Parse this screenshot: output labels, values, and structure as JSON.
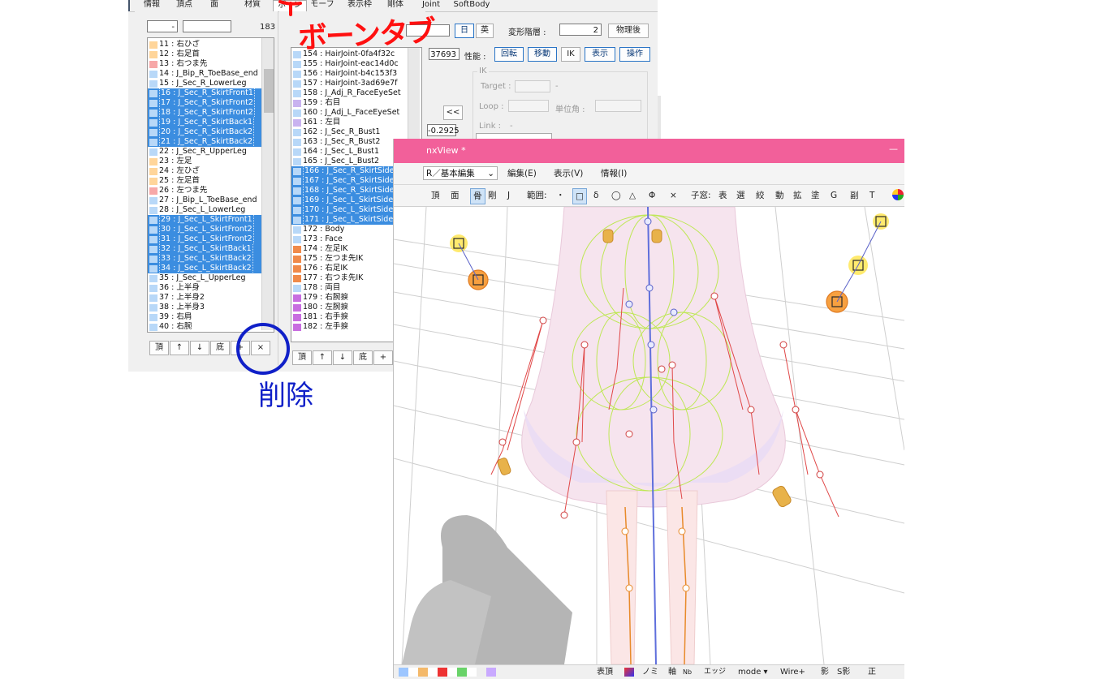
{
  "tabs": [
    "情報",
    "頂点",
    "面",
    "材質",
    "ボーン",
    "モーフ",
    "表示枠",
    "剛体",
    "Joint",
    "SoftBody"
  ],
  "active_tab": "ボーン",
  "left": {
    "spin_value": "-",
    "name_value": "",
    "count": "183",
    "rows": [
      {
        "label": "11 : 右ひざ",
        "color": "#ffd59a",
        "sel": false
      },
      {
        "label": "12 : 右足首",
        "color": "#ffd59a",
        "sel": false
      },
      {
        "label": "13 : 右つま先",
        "color": "#f7a8a8",
        "sel": false
      },
      {
        "label": "14 : J_Bip_R_ToeBase_end",
        "color": "#b8d8f8",
        "sel": false
      },
      {
        "label": "15 : J_Sec_R_LowerLeg",
        "color": "#b8d8f8",
        "sel": false
      },
      {
        "label": "16 : J_Sec_R_SkirtFront1",
        "color": "#b8d8f8",
        "sel": true
      },
      {
        "label": "17 : J_Sec_R_SkirtFront2",
        "color": "#b8d8f8",
        "sel": true
      },
      {
        "label": "18 : J_Sec_R_SkirtFront2",
        "color": "#b8d8f8",
        "sel": true
      },
      {
        "label": "19 : J_Sec_R_SkirtBack1",
        "color": "#b8d8f8",
        "sel": true
      },
      {
        "label": "20 : J_Sec_R_SkirtBack2",
        "color": "#b8d8f8",
        "sel": true
      },
      {
        "label": "21 : J_Sec_R_SkirtBack2",
        "color": "#b8d8f8",
        "sel": true
      },
      {
        "label": "22 : J_Sec_R_UpperLeg",
        "color": "#b8d8f8",
        "sel": false
      },
      {
        "label": "23 : 左足",
        "color": "#ffd59a",
        "sel": false
      },
      {
        "label": "24 : 左ひざ",
        "color": "#ffd59a",
        "sel": false
      },
      {
        "label": "25 : 左足首",
        "color": "#ffd59a",
        "sel": false
      },
      {
        "label": "26 : 左つま先",
        "color": "#f7a8a8",
        "sel": false
      },
      {
        "label": "27 : J_Bip_L_ToeBase_end",
        "color": "#b8d8f8",
        "sel": false
      },
      {
        "label": "28 : J_Sec_L_LowerLeg",
        "color": "#b8d8f8",
        "sel": false
      },
      {
        "label": "29 : J_Sec_L_SkirtFront1",
        "color": "#b8d8f8",
        "sel": true
      },
      {
        "label": "30 : J_Sec_L_SkirtFront2",
        "color": "#b8d8f8",
        "sel": true
      },
      {
        "label": "31 : J_Sec_L_SkirtFront2",
        "color": "#b8d8f8",
        "sel": true
      },
      {
        "label": "32 : J_Sec_L_SkirtBack1",
        "color": "#b8d8f8",
        "sel": true
      },
      {
        "label": "33 : J_Sec_L_SkirtBack2",
        "color": "#b8d8f8",
        "sel": true
      },
      {
        "label": "34 : J_Sec_L_SkirtBack2",
        "color": "#b8d8f8",
        "sel": true
      },
      {
        "label": "35 : J_Sec_L_UpperLeg",
        "color": "#b8d8f8",
        "sel": false
      },
      {
        "label": "36 : 上半身",
        "color": "#b8d8f8",
        "sel": false
      },
      {
        "label": "37 : 上半身2",
        "color": "#b8d8f8",
        "sel": false
      },
      {
        "label": "38 : 上半身3",
        "color": "#b8d8f8",
        "sel": false
      },
      {
        "label": "39 : 右肩",
        "color": "#b8d8f8",
        "sel": false
      },
      {
        "label": "40 : 右腕",
        "color": "#b8d8f8",
        "sel": false
      }
    ],
    "buttons": [
      "頂",
      "↑",
      "↓",
      "底",
      "+",
      "×"
    ]
  },
  "mid": {
    "rows": [
      {
        "label": "154 : HairJoint-0fa4f32c",
        "color": "#b8d8f8",
        "sel": false
      },
      {
        "label": "155 : HairJoint-eac14d0c",
        "color": "#b8d8f8",
        "sel": false
      },
      {
        "label": "156 : HairJoint-b4c153f3",
        "color": "#b8d8f8",
        "sel": false
      },
      {
        "label": "157 : HairJoint-3ad69e7f",
        "color": "#b8d8f8",
        "sel": false
      },
      {
        "label": "158 : J_Adj_R_FaceEyeSet",
        "color": "#b8d8f8",
        "sel": false
      },
      {
        "label": "159 : 右目",
        "color": "#c9b3f0",
        "sel": false
      },
      {
        "label": "160 : J_Adj_L_FaceEyeSet",
        "color": "#b8d8f8",
        "sel": false
      },
      {
        "label": "161 : 左目",
        "color": "#c9b3f0",
        "sel": false
      },
      {
        "label": "162 : J_Sec_R_Bust1",
        "color": "#b8d8f8",
        "sel": false
      },
      {
        "label": "163 : J_Sec_R_Bust2",
        "color": "#b8d8f8",
        "sel": false
      },
      {
        "label": "164 : J_Sec_L_Bust1",
        "color": "#b8d8f8",
        "sel": false
      },
      {
        "label": "165 : J_Sec_L_Bust2",
        "color": "#b8d8f8",
        "sel": false
      },
      {
        "label": "166 : J_Sec_R_SkirtSide1",
        "color": "#b8d8f8",
        "sel": true
      },
      {
        "label": "167 : J_Sec_R_SkirtSide2",
        "color": "#b8d8f8",
        "sel": true
      },
      {
        "label": "168 : J_Sec_R_SkirtSide2",
        "color": "#b8d8f8",
        "sel": true
      },
      {
        "label": "169 : J_Sec_L_SkirtSide1",
        "color": "#b8d8f8",
        "sel": true
      },
      {
        "label": "170 : J_Sec_L_SkirtSide2",
        "color": "#b8d8f8",
        "sel": true
      },
      {
        "label": "171 : J_Sec_L_SkirtSide2",
        "color": "#b8d8f8",
        "sel": true
      },
      {
        "label": "172 : Body",
        "color": "#b8d8f8",
        "sel": false
      },
      {
        "label": "173 : Face",
        "color": "#b8d8f8",
        "sel": false
      },
      {
        "label": "174 : 左足IK",
        "color": "#f08a4a",
        "sel": false
      },
      {
        "label": "175 : 左つま先IK",
        "color": "#f08a4a",
        "sel": false
      },
      {
        "label": "176 : 右足IK",
        "color": "#f08a4a",
        "sel": false
      },
      {
        "label": "177 : 右つま先IK",
        "color": "#f08a4a",
        "sel": false
      },
      {
        "label": "178 : 両目",
        "color": "#b8d8f8",
        "sel": false
      },
      {
        "label": "179 : 右腕捩",
        "color": "#c86ee0",
        "sel": false
      },
      {
        "label": "180 : 左腕捩",
        "color": "#c86ee0",
        "sel": false
      },
      {
        "label": "181 : 右手捩",
        "color": "#c86ee0",
        "sel": false
      },
      {
        "label": "182 : 左手捩",
        "color": "#c86ee0",
        "sel": false
      }
    ],
    "buttons": [
      "頂",
      "↑",
      "↓",
      "底",
      "+",
      "×"
    ]
  },
  "props": {
    "lang_ja": "日",
    "lang_en": "英",
    "deform_label": "変形階層 :",
    "deform_value": "2",
    "after_physics": "物理後",
    "coord_value": "37693",
    "perf_label": "性能 :",
    "perf_buttons": [
      "回転",
      "移動",
      "IK",
      "表示",
      "操作"
    ],
    "ik_group": "IK",
    "target_label": "Target :",
    "target_dash": "-",
    "loop_label": "Loop :",
    "unit_angle_label": "単位角 :",
    "link_label": "Link :",
    "link_dash": "-",
    "collapse_btn": "<<",
    "value_field": "-0.2925"
  },
  "annotations": {
    "bone_tab_note": "ボーンタブ",
    "delete_note": "削除"
  },
  "viewer": {
    "title": "nxView *",
    "title_btn": "—",
    "mode_dropdown": "R／基本編集",
    "menus": [
      "編集(E)",
      "表示(V)",
      "情報(I)"
    ],
    "toolbar": [
      "頂",
      "面",
      "骨",
      "剛",
      "J",
      "範囲:",
      "・",
      "□",
      "δ",
      "◯",
      "△",
      "Φ",
      "×",
      "子窓:",
      "表",
      "選",
      "絞",
      "動",
      "拡",
      "塗",
      "G",
      "副",
      "T"
    ],
    "status": [
      "表頂",
      "ノミ",
      "軸",
      "Nb",
      "エッジ",
      "mode ▾",
      "Wire+",
      "影",
      "S影",
      "正"
    ]
  },
  "colors": {
    "title_pink": "#f2609a",
    "selection_blue": "#3b8de0",
    "annotation_red": "#ff1010",
    "annotation_blue": "#1020c8"
  }
}
